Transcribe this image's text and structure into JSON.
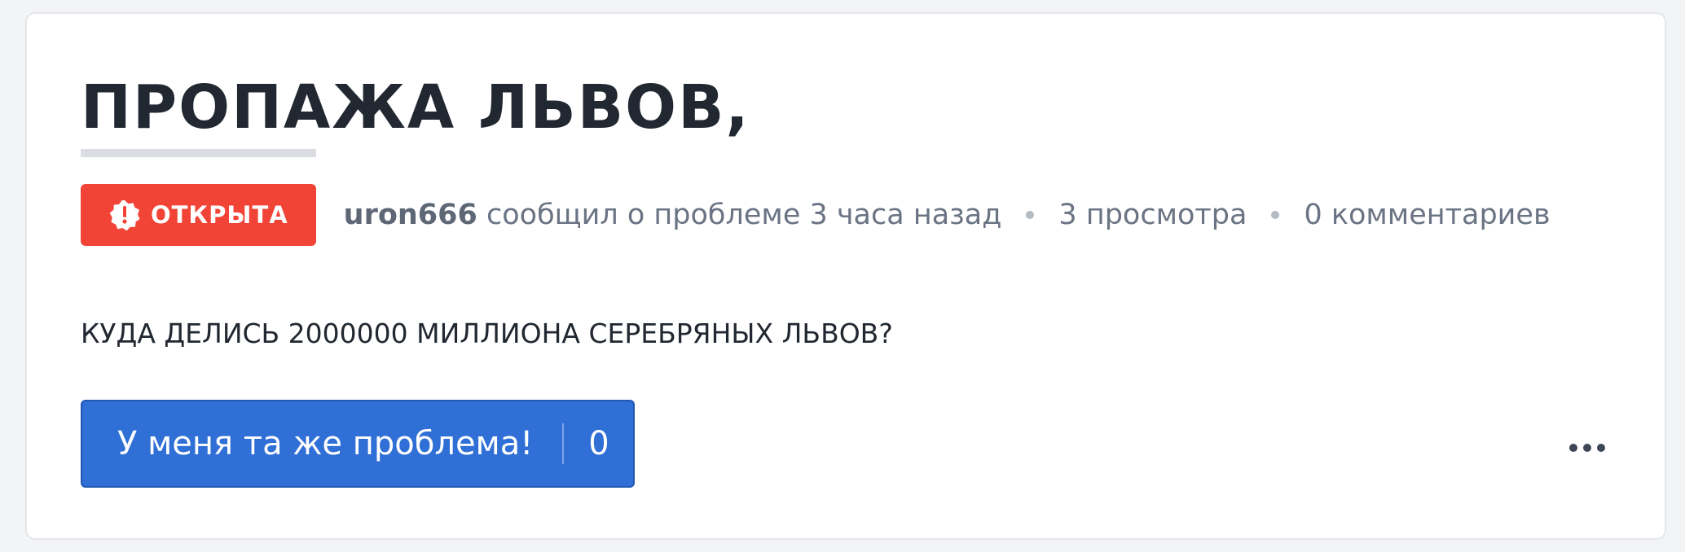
{
  "issue": {
    "title": "ПРОПАЖА ЛЬВОВ,",
    "status": "ОТКРЫТА",
    "author": "uron666",
    "reported_text": "сообщил о проблеме 3 часа назад",
    "views": "3 просмотра",
    "comments": "0 комментариев",
    "body": "КУДА ДЕЛИСЬ 2000000 МИЛЛИОНА СЕРЕБРЯНЫХ ЛЬВОВ?"
  },
  "actions": {
    "same_problem_label": "У меня та же проблема!",
    "same_problem_count": "0",
    "more_icon": "more-horizontal-icon"
  },
  "colors": {
    "status_open": "#f14336",
    "primary_button": "#2f6fd6",
    "title_text": "#222831",
    "meta_text": "#6b7484"
  },
  "icons": {
    "status": "alert-badge-icon"
  }
}
